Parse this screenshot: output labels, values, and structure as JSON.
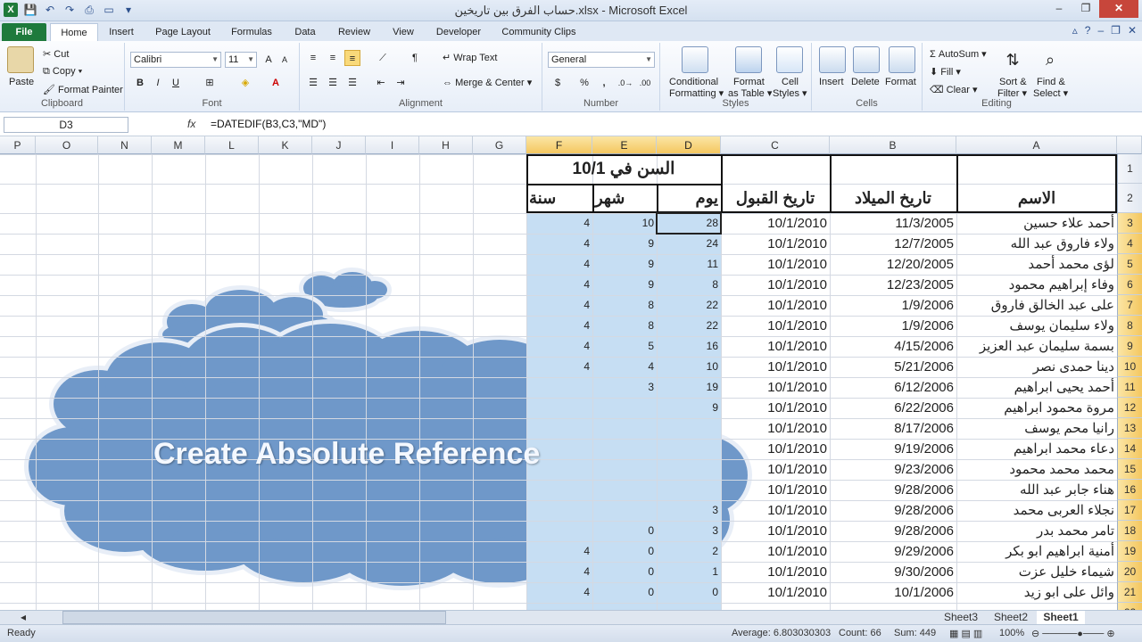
{
  "window": {
    "title": "حساب الفرق بين تاريخين.xlsx - Microsoft Excel",
    "logo": "X",
    "minimize": "–",
    "restore": "❐",
    "close": "✕"
  },
  "tabs": {
    "file": "File",
    "items": [
      "Home",
      "Insert",
      "Page Layout",
      "Formulas",
      "Data",
      "Review",
      "View",
      "Developer",
      "Community Clips"
    ]
  },
  "ribbon": {
    "clipboard": {
      "paste": "Paste",
      "cut": "Cut",
      "copy": "Copy ▾",
      "format_painter": "Format Painter",
      "label": "Clipboard"
    },
    "font": {
      "name": "Calibri",
      "size": "11",
      "bold": "B",
      "italic": "I",
      "underline": "U",
      "label": "Font"
    },
    "alignment": {
      "wrap_text": "Wrap Text",
      "merge_center": "Merge & Center",
      "label": "Alignment"
    },
    "number": {
      "format": "General",
      "currency": "$",
      "percent": "%",
      "comma": ",",
      "label": "Number"
    },
    "styles": {
      "conditional": "Conditional",
      "formatting": "Formatting ▾",
      "format": "Format",
      "as_table": "as Table ▾",
      "cell": "Cell",
      "cell_styles": "Styles ▾",
      "label": "Styles"
    },
    "cells": {
      "insert": "Insert",
      "delete": "Delete",
      "format": "Format",
      "label": "Cells"
    },
    "editing": {
      "autosum": "AutoSum ▾",
      "fill": "Fill ▾",
      "clear": "Clear ▾",
      "sort": "Sort &",
      "sort2": "Filter ▾",
      "find": "Find &",
      "find2": "Select ▾",
      "label": "Editing"
    }
  },
  "formula_bar": {
    "name_box": "D3",
    "fx": "fx",
    "formula": "=DATEDIF(B3,C3,\"MD\")"
  },
  "columns": [
    "P",
    "O",
    "N",
    "M",
    "L",
    "K",
    "J",
    "I",
    "H",
    "G",
    "F",
    "E",
    "D",
    "C",
    "B",
    "A"
  ],
  "header_row1": {
    "age_at": "السن في 10/1"
  },
  "header_row2": {
    "year": "سنة",
    "month": "شهر",
    "day": "يوم",
    "admission": "تاريخ القبول",
    "birth": "تاريخ الميلاد",
    "name": "الاسم"
  },
  "rows": [
    {
      "n": "3",
      "name": "أحمد علاء حسين",
      "birth": "11/3/2005",
      "adm": "10/1/2010",
      "day": "28",
      "month": "10",
      "year": "4"
    },
    {
      "n": "4",
      "name": "ولاء فاروق عبد الله",
      "birth": "12/7/2005",
      "adm": "10/1/2010",
      "day": "24",
      "month": "9",
      "year": "4"
    },
    {
      "n": "5",
      "name": "لؤى محمد أحمد",
      "birth": "12/20/2005",
      "adm": "10/1/2010",
      "day": "11",
      "month": "9",
      "year": "4"
    },
    {
      "n": "6",
      "name": "وفاء إبراهيم محمود",
      "birth": "12/23/2005",
      "adm": "10/1/2010",
      "day": "8",
      "month": "9",
      "year": "4"
    },
    {
      "n": "7",
      "name": "على عبد الخالق فاروق",
      "birth": "1/9/2006",
      "adm": "10/1/2010",
      "day": "22",
      "month": "8",
      "year": "4"
    },
    {
      "n": "8",
      "name": "ولاء سليمان يوسف",
      "birth": "1/9/2006",
      "adm": "10/1/2010",
      "day": "22",
      "month": "8",
      "year": "4"
    },
    {
      "n": "9",
      "name": "بسمة سليمان عبد العزيز",
      "birth": "4/15/2006",
      "adm": "10/1/2010",
      "day": "16",
      "month": "5",
      "year": "4"
    },
    {
      "n": "10",
      "name": "دينا حمدى نصر",
      "birth": "5/21/2006",
      "adm": "10/1/2010",
      "day": "10",
      "month": "4",
      "year": "4"
    },
    {
      "n": "11",
      "name": "أحمد يحيى ابراهيم",
      "birth": "6/12/2006",
      "adm": "10/1/2010",
      "day": "19",
      "month": "3",
      "year": ""
    },
    {
      "n": "12",
      "name": "مروة محمود ابراهيم",
      "birth": "6/22/2006",
      "adm": "10/1/2010",
      "day": "9",
      "month": "",
      "year": ""
    },
    {
      "n": "13",
      "name": "رانيا محم يوسف",
      "birth": "8/17/2006",
      "adm": "10/1/2010",
      "day": "",
      "month": "",
      "year": ""
    },
    {
      "n": "14",
      "name": "دعاء محمد ابراهيم",
      "birth": "9/19/2006",
      "adm": "10/1/2010",
      "day": "",
      "month": "",
      "year": ""
    },
    {
      "n": "15",
      "name": "محمد محمد محمود",
      "birth": "9/23/2006",
      "adm": "10/1/2010",
      "day": "",
      "month": "",
      "year": ""
    },
    {
      "n": "16",
      "name": "هناء جابر عبد الله",
      "birth": "9/28/2006",
      "adm": "10/1/2010",
      "day": "",
      "month": "",
      "year": ""
    },
    {
      "n": "17",
      "name": "نجلاء العربى محمد",
      "birth": "9/28/2006",
      "adm": "10/1/2010",
      "day": "3",
      "month": "",
      "year": ""
    },
    {
      "n": "18",
      "name": "تامر محمد بدر",
      "birth": "9/28/2006",
      "adm": "10/1/2010",
      "day": "3",
      "month": "0",
      "year": ""
    },
    {
      "n": "19",
      "name": "أمنية ابراهيم ابو بكر",
      "birth": "9/29/2006",
      "adm": "10/1/2010",
      "day": "2",
      "month": "0",
      "year": "4"
    },
    {
      "n": "20",
      "name": "شيماء خليل عزت",
      "birth": "9/30/2006",
      "adm": "10/1/2010",
      "day": "1",
      "month": "0",
      "year": "4"
    },
    {
      "n": "21",
      "name": "وائل على ابو زيد",
      "birth": "10/1/2006",
      "adm": "10/1/2010",
      "day": "0",
      "month": "0",
      "year": "4"
    }
  ],
  "callout": {
    "text": "Create Absolute Reference"
  },
  "sheets": [
    "Sheet3",
    "Sheet2",
    "Sheet1"
  ],
  "status": {
    "ready": "Ready",
    "average": "Average: 6.803030303",
    "count": "Count: 66",
    "sum": "Sum: 449",
    "zoom": "100%"
  },
  "colors": {
    "selection": "#c6def3",
    "header_sel": "#f4c760",
    "cloud": "#6f98c9",
    "file_tab": "#1e7a3c"
  }
}
